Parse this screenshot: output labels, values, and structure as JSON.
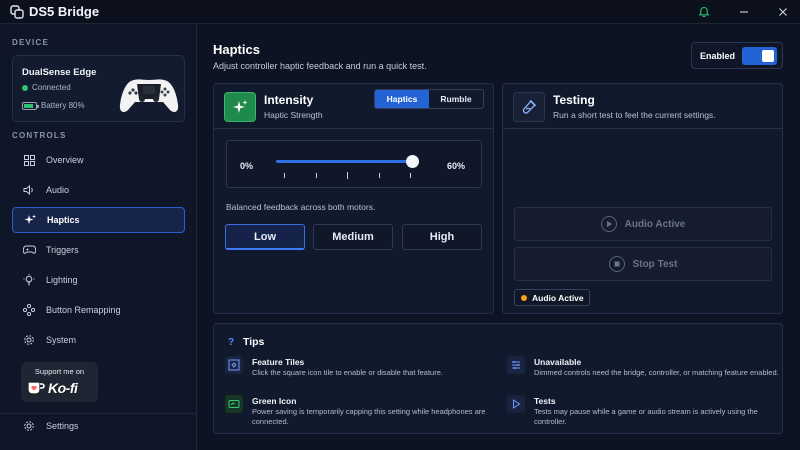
{
  "app": {
    "title": "DS5 Bridge"
  },
  "sidebar": {
    "device_section": "DEVICE",
    "device": {
      "name": "DualSense Edge",
      "status": "Connected",
      "battery": "Battery 80%",
      "battery_level": 0.8
    },
    "controls_section": "CONTROLS",
    "items": [
      {
        "label": "Overview",
        "icon": "grid-icon"
      },
      {
        "label": "Audio",
        "icon": "speaker-icon"
      },
      {
        "label": "Haptics",
        "icon": "sparkle-icon",
        "active": true
      },
      {
        "label": "Triggers",
        "icon": "gamepad-icon"
      },
      {
        "label": "Lighting",
        "icon": "bulb-icon"
      },
      {
        "label": "Button Remapping",
        "icon": "dpad-icon"
      },
      {
        "label": "System",
        "icon": "gear-icon"
      }
    ],
    "support": {
      "top": "Support me on",
      "brand": "Ko-fi"
    },
    "settings": "Settings"
  },
  "header": {
    "title": "Haptics",
    "subtitle": "Adjust controller haptic feedback and run a quick test.",
    "enabled_label": "Enabled",
    "enabled": true
  },
  "intensity": {
    "title": "Intensity",
    "subtitle": "Haptic Strength",
    "tabs": [
      "Haptics",
      "Rumble"
    ],
    "active_tab": "Haptics",
    "slider_min": "0%",
    "slider_value": "60%",
    "slider_fraction": 1.0,
    "description": "Balanced feedback across both motors.",
    "levels": [
      "Low",
      "Medium",
      "High"
    ],
    "active_level": "Low"
  },
  "testing": {
    "title": "Testing",
    "subtitle": "Run a short test to feel the current settings.",
    "audio_button": "Audio Active",
    "stop_button": "Stop Test",
    "status": "Audio Active"
  },
  "tips": {
    "title": "Tips",
    "items": [
      {
        "title": "Feature Tiles",
        "text": "Click the square icon tile to enable or disable that feature.",
        "icon": "tile-icon"
      },
      {
        "title": "Unavailable",
        "text": "Dimmed controls need the bridge, controller, or matching feature enabled.",
        "icon": "sliders-icon"
      },
      {
        "title": "Green Icon",
        "text": "Power saving is temporarily capping this setting while headphones are connected.",
        "icon": "power-save-icon"
      },
      {
        "title": "Tests",
        "text": "Tests may pause while a game or audio stream is actively using the controller.",
        "icon": "play-icon"
      }
    ]
  },
  "colors": {
    "accent": "#2463d6",
    "success": "#2fc36a",
    "warning": "#f3a51f",
    "background": "#0d1322"
  }
}
